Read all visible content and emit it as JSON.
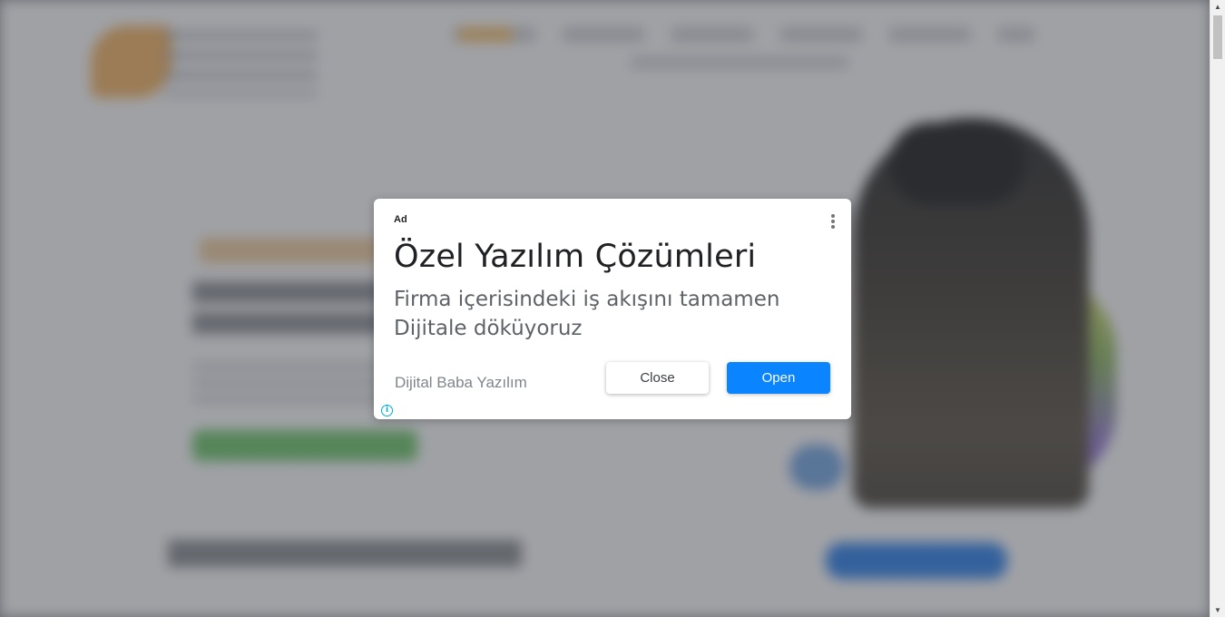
{
  "ad": {
    "label": "Ad",
    "title": "Özel Yazılım Çözümleri",
    "description": "Firma içerisindeki iş akışını tamamen Dijitale döküyoruz",
    "advertiser": "Dijital Baba Yazılım",
    "close_label": "Close",
    "open_label": "Open",
    "menu_icon": "more-vert-icon",
    "info_icon": "info-icon",
    "info_glyph": "i"
  },
  "scrollbar": {
    "up_glyph": "▲",
    "down_glyph": "▼"
  },
  "colors": {
    "open_button": "#0a84ff",
    "info_icon": "#00aecd"
  }
}
